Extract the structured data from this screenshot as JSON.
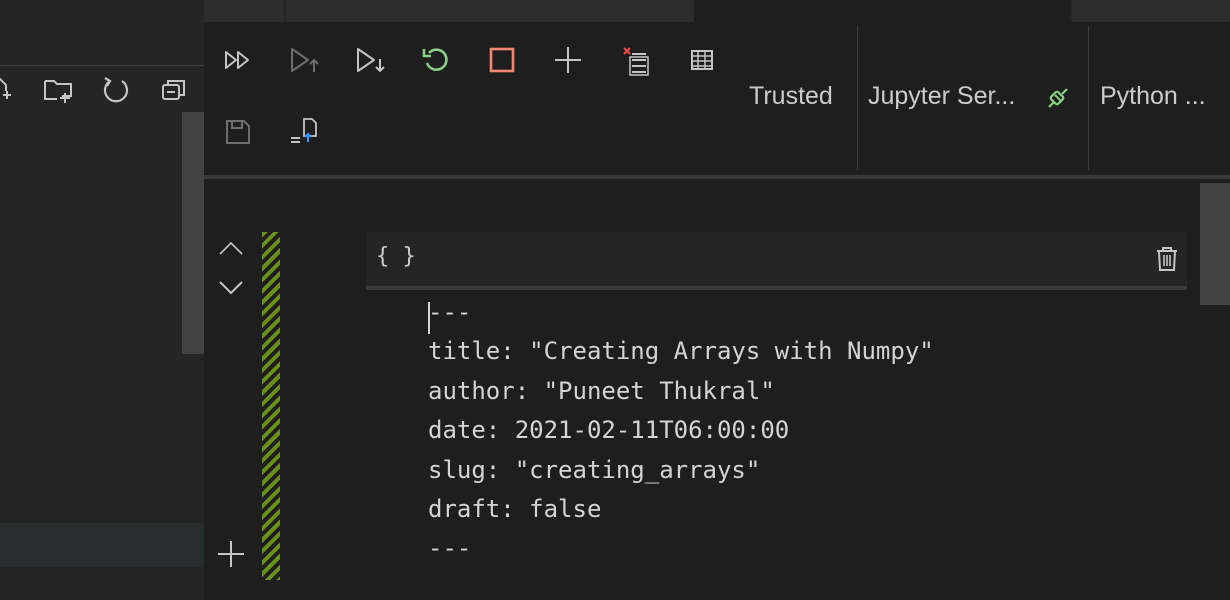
{
  "toolbar": {
    "trusted_label": "Trusted",
    "server_label": "Jupyter Ser...",
    "kernel_label": "Python ..."
  },
  "cell": {
    "type_label": "{ }",
    "lines": [
      "---",
      "title: \"Creating Arrays with Numpy\"",
      "author: \"Puneet Thukral\"",
      "date: 2021-02-11T06:00:00",
      "slug: \"creating_arrays\"",
      "draft: false",
      "---"
    ]
  },
  "colors": {
    "accent_green": "#89d185",
    "stop_red": "#f48771",
    "restart_green": "#89d185",
    "status_stripe": "#6a8f1a"
  },
  "icons": {
    "explorer": [
      "new-file-icon",
      "new-folder-icon",
      "refresh-icon",
      "collapse-all-icon"
    ],
    "toolbar": [
      "run-all-icon",
      "run-above-icon",
      "run-below-icon",
      "restart-kernel-icon",
      "interrupt-kernel-icon",
      "add-cell-icon",
      "clear-outputs-icon",
      "variables-icon",
      "save-icon",
      "export-icon",
      "kernel-connected-icon"
    ],
    "cell": [
      "move-up-icon",
      "move-down-icon",
      "add-cell-below-icon",
      "delete-icon"
    ]
  }
}
